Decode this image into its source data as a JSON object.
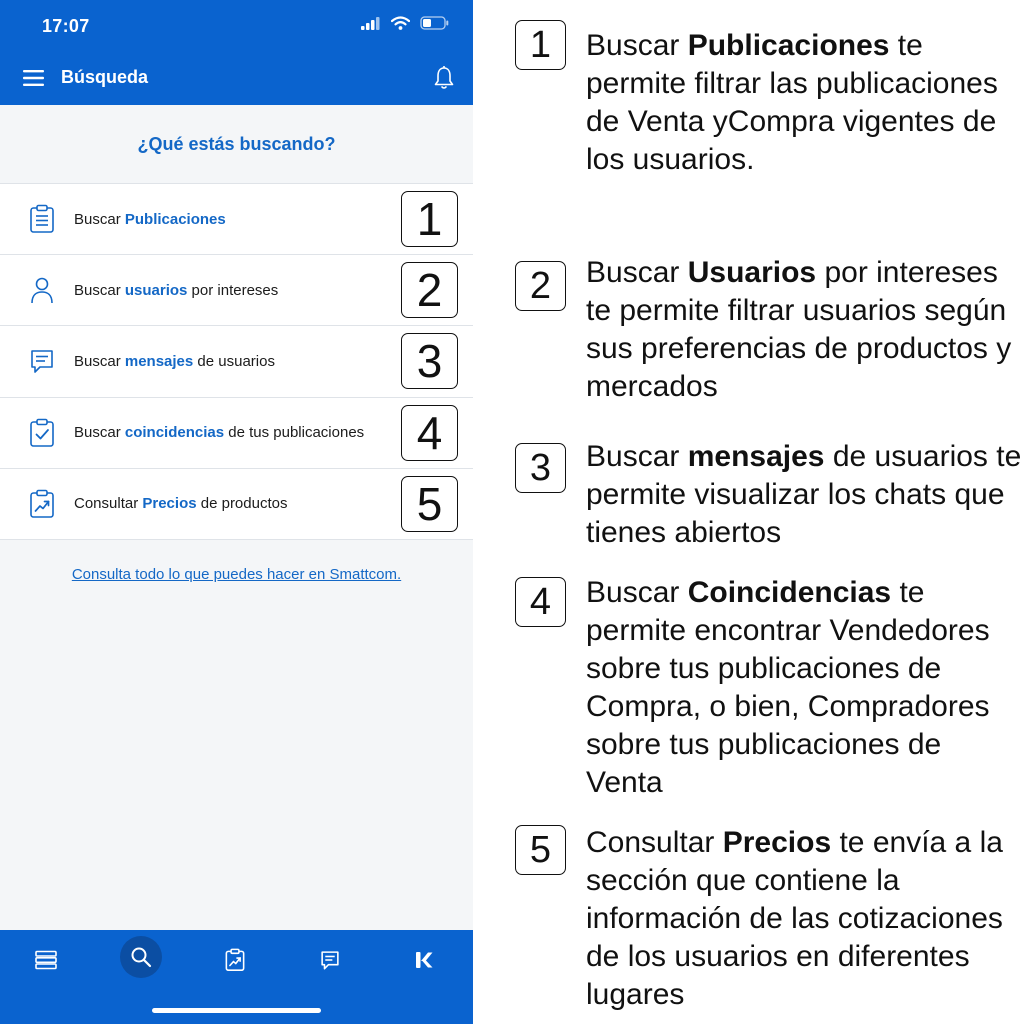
{
  "status_bar": {
    "time": "17:07"
  },
  "header": {
    "title": "Búsqueda"
  },
  "question": "¿Qué estás buscando?",
  "menu": [
    {
      "before": "Buscar ",
      "keyword": "Publicaciones",
      "after": "",
      "number": "1",
      "icon": "clipboard-list-icon"
    },
    {
      "before": "Buscar ",
      "keyword": "usuarios",
      "after": " por intereses",
      "number": "2",
      "icon": "user-icon"
    },
    {
      "before": "Buscar ",
      "keyword": "mensajes",
      "after": " de usuarios",
      "number": "3",
      "icon": "message-icon"
    },
    {
      "before": "Buscar ",
      "keyword": "coincidencias",
      "after": " de tus publicaciones",
      "number": "4",
      "icon": "clipboard-check-icon"
    },
    {
      "before": "Consultar ",
      "keyword": "Precios",
      "after": " de productos",
      "number": "5",
      "icon": "clipboard-chart-icon"
    }
  ],
  "help_link": "Consulta todo lo que puedes hacer en Smattcom.",
  "bottom_nav": [
    {
      "icon": "list-icon",
      "active": false
    },
    {
      "icon": "search-icon",
      "active": true
    },
    {
      "icon": "clipboard-chart-icon",
      "active": false
    },
    {
      "icon": "message-icon",
      "active": false
    },
    {
      "icon": "k-logo-icon",
      "active": false
    }
  ],
  "explanations": [
    {
      "number": "1",
      "lead": "Buscar ",
      "bold": "Publicaciones",
      "rest": " te permite filtrar las publicaciones de Venta yCompra vigentes de los usuarios."
    },
    {
      "number": "2",
      "lead": "Buscar ",
      "bold": "Usuarios",
      "rest": " por intereses te permite filtrar usuarios según sus preferencias de productos y mercados"
    },
    {
      "number": "3",
      "lead": "Buscar ",
      "bold": "mensajes",
      "rest": " de usuarios te permite visualizar los chats que tienes abiertos"
    },
    {
      "number": "4",
      "lead": "Buscar ",
      "bold": "Coincidencias",
      "rest": " te permite encontrar Vendedores sobre tus publicaciones de Compra, o bien, Compradores sobre tus publicaciones de Venta"
    },
    {
      "number": "5",
      "lead": "Consultar ",
      "bold": "Precios",
      "rest": " te envía a la sección que contiene la información de las cotizaciones de los usuarios en diferentes lugares"
    }
  ],
  "colors": {
    "brand_blue": "#0a63cf",
    "link_blue": "#1468c6",
    "nav_active": "#0b4ea3"
  }
}
